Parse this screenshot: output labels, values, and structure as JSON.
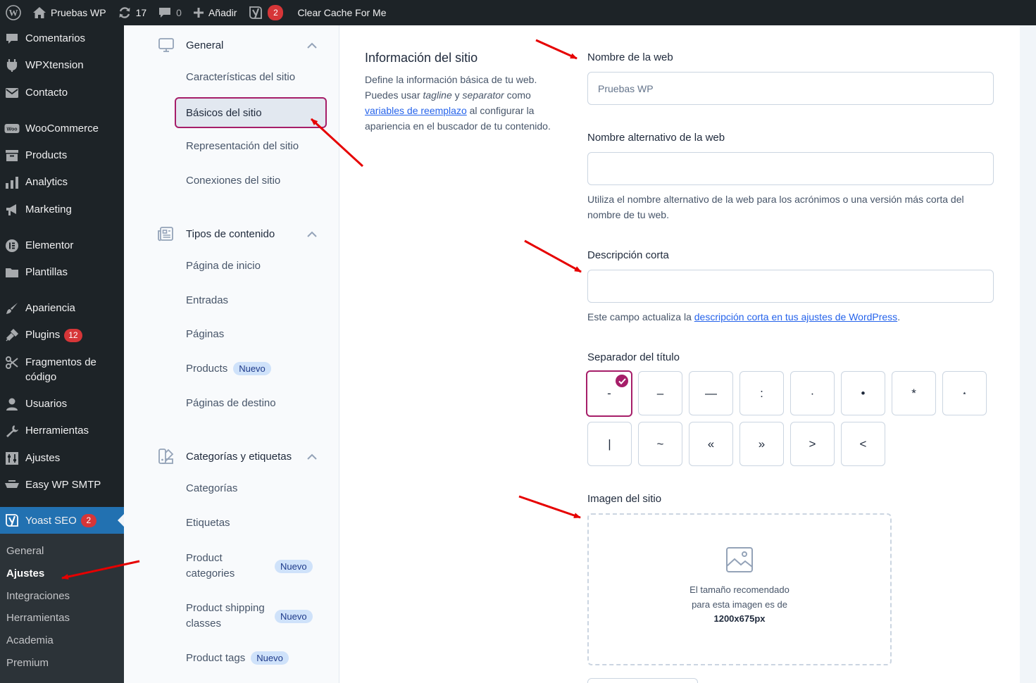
{
  "adminbar": {
    "site_name": "Pruebas WP",
    "updates_count": "17",
    "comments_count": "0",
    "add_new": "Añadir",
    "yoast_count": "2",
    "clear_cache": "Clear Cache For Me"
  },
  "adminmenu": {
    "items": [
      {
        "label": "Comentarios",
        "icon": "comment-icon"
      },
      {
        "label": "WPXtension",
        "icon": "plug-icon"
      },
      {
        "label": "Contacto",
        "icon": "mail-icon"
      },
      {
        "label": "WooCommerce",
        "icon": "woo-icon"
      },
      {
        "label": "Products",
        "icon": "archive-icon"
      },
      {
        "label": "Analytics",
        "icon": "chart-icon"
      },
      {
        "label": "Marketing",
        "icon": "megaphone-icon"
      },
      {
        "label": "Elementor",
        "icon": "elementor-icon"
      },
      {
        "label": "Plantillas",
        "icon": "folder-icon"
      },
      {
        "label": "Apariencia",
        "icon": "brush-icon"
      },
      {
        "label": "Plugins",
        "icon": "plugin-icon",
        "badge": "12"
      },
      {
        "label": "Fragmentos de código",
        "icon": "scissors-icon"
      },
      {
        "label": "Usuarios",
        "icon": "user-icon"
      },
      {
        "label": "Herramientas",
        "icon": "wrench-icon"
      },
      {
        "label": "Ajustes",
        "icon": "sliders-icon"
      },
      {
        "label": "Easy WP SMTP",
        "icon": "smtp-icon"
      }
    ],
    "active": {
      "label": "Yoast SEO",
      "badge": "2"
    },
    "submenu": [
      "General",
      "Ajustes",
      "Integraciones",
      "Herramientas",
      "Academia",
      "Premium"
    ]
  },
  "subnav": {
    "general": {
      "title": "General",
      "links": [
        "Características del sitio",
        "Básicos del sitio",
        "Representación del sitio",
        "Conexiones del sitio"
      ]
    },
    "content_types": {
      "title": "Tipos de contenido",
      "links": [
        "Página de inicio",
        "Entradas",
        "Páginas",
        "Products",
        "Páginas de destino"
      ],
      "products_badge": "Nuevo"
    },
    "taxonomies": {
      "title": "Categorías y etiquetas",
      "links": [
        "Categorías",
        "Etiquetas",
        "Product categories",
        "Product shipping classes",
        "Product tags"
      ],
      "badge": "Nuevo"
    }
  },
  "main": {
    "section_title": "Información del sitio",
    "section_desc": {
      "p1": "Define la información básica de tu web. Puedes usar ",
      "tagline": "tagline",
      "y": " y ",
      "separator": "separator",
      "p2": " como ",
      "link": "variables de reemplazo",
      "p3": " al configurar la apariencia en el buscador de tu contenido."
    },
    "site_name": {
      "label": "Nombre de la web",
      "value": "",
      "placeholder": "Pruebas WP"
    },
    "alt_name": {
      "label": "Nombre alternativo de la web",
      "value": "",
      "help": "Utiliza el nombre alternativo de la web para los acrónimos o una versión más corta del nombre de tu web."
    },
    "tagline": {
      "label": "Descripción corta",
      "value": "",
      "help_prefix": "Este campo actualiza la ",
      "help_link": "descripción corta en tus ajustes de WordPress",
      "help_suffix": "."
    },
    "separator": {
      "label": "Separador del título",
      "options": [
        "-",
        "–",
        "—",
        ":",
        "·",
        "•",
        "*",
        "⋆",
        "|",
        "~",
        "«",
        "»",
        ">",
        "<"
      ],
      "selected": "-"
    },
    "site_image": {
      "label": "Imagen del sitio",
      "text": "El tamaño recomendado para esta imagen es de",
      "size": "1200x675px"
    }
  },
  "colors": {
    "wp_dark": "#1d2327",
    "wp_blue": "#2271b1",
    "yoast_primary": "#a61e69",
    "badge_red": "#d63638",
    "annotation_red": "#e60000"
  }
}
